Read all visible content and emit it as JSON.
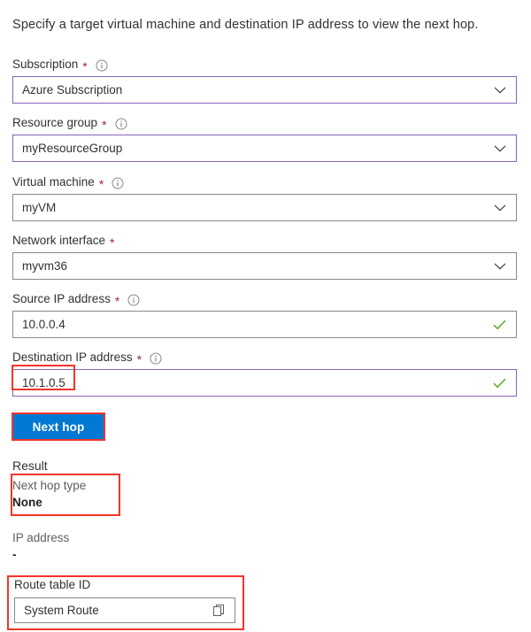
{
  "intro": {
    "text": "Specify a target virtual machine and destination IP address to view the next hop."
  },
  "colors": {
    "accent_border": "#8764b8",
    "neutral_border": "#8a8886",
    "primary_button": "#0078d4",
    "annotation": "#f4352a",
    "valid_check": "#5ea72a",
    "required_star": "#a4262c"
  },
  "form": {
    "fields": [
      {
        "label": "Subscription",
        "required": true,
        "info": true,
        "info_icon": "info-circle-icon",
        "type": "dropdown",
        "value": "Azure Subscription",
        "trailing_icon": "chevron-down-icon",
        "focused": true,
        "name": "subscription"
      },
      {
        "label": "Resource group",
        "required": true,
        "info": true,
        "info_icon": "info-circle-icon",
        "type": "dropdown",
        "value": "myResourceGroup",
        "trailing_icon": "chevron-down-icon",
        "focused": true,
        "name": "resource-group"
      },
      {
        "label": "Virtual machine",
        "required": true,
        "info": true,
        "info_icon": "info-circle-icon",
        "type": "dropdown",
        "value": "myVM",
        "trailing_icon": "chevron-down-icon",
        "focused": false,
        "name": "virtual-machine"
      },
      {
        "label": "Network interface",
        "required": true,
        "info": false,
        "info_icon": "",
        "type": "dropdown",
        "value": "myvm36",
        "trailing_icon": "chevron-down-icon",
        "focused": false,
        "name": "network-interface"
      },
      {
        "label": "Source IP address",
        "required": true,
        "info": true,
        "info_icon": "info-circle-icon",
        "type": "text",
        "value": "10.0.0.4",
        "trailing_icon": "check-valid-icon",
        "focused": false,
        "name": "source-ip-address"
      },
      {
        "label": "Destination IP address",
        "required": true,
        "info": true,
        "info_icon": "info-circle-icon",
        "type": "text",
        "value": "10.1.0.5",
        "trailing_icon": "check-valid-icon",
        "focused": true,
        "name": "destination-ip-address"
      }
    ]
  },
  "actions": {
    "next_hop_label": "Next hop"
  },
  "result": {
    "heading": "Result",
    "next_hop_type_label": "Next hop type",
    "next_hop_type_value": "None",
    "ip_address_label": "IP address",
    "ip_address_value": "-",
    "route_table_id_label": "Route table ID",
    "route_table_id_value": "System Route",
    "copy_icon": "copy-icon"
  }
}
